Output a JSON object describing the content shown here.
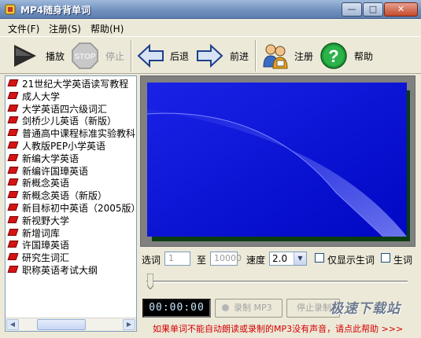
{
  "window": {
    "title": "MP4随身背单词",
    "minimize": "—",
    "maximize": "□",
    "close": "✕"
  },
  "menu": [
    "文件(F)",
    "注册(S)",
    "帮助(H)"
  ],
  "toolbar": {
    "play": "播放",
    "stop": "停止",
    "stop_sign": "STOP",
    "back": "后退",
    "forward": "前进",
    "register": "注册",
    "help": "帮助"
  },
  "books": [
    "21世纪大学英语读写教程",
    "成人大学",
    "大学英语四六级词汇",
    "剑桥少儿英语（新版）",
    "普通高中课程标准实验教科",
    "人教版PEP小学英语",
    "新编大学英语",
    "新编许国璋英语",
    "新概念英语",
    "新概念英语（新版）",
    "新目标初中英语（2005版）",
    "新视野大学",
    "新增词库",
    "许国璋英语",
    "研究生词汇",
    "职称英语考试大纲"
  ],
  "controls": {
    "select_label": "选词",
    "from_value": "1",
    "to_label": "至",
    "to_value": "10000",
    "speed_label": "速度",
    "speed_value": "2.0",
    "only_show_new": "仅显示生词",
    "new_words": "生词"
  },
  "playback": {
    "time": "00:00:00",
    "record": "录制 MP3",
    "stop_record": "停止录制"
  },
  "watermark": "极速下载站",
  "help_line": "如果单词不能自动朗读或录制的MP3没有声音，请点此帮助 >>>",
  "colors": {
    "screen_blue": "#0a12d8",
    "help_red": "#d40000",
    "book_icon_red": "#d41414"
  }
}
